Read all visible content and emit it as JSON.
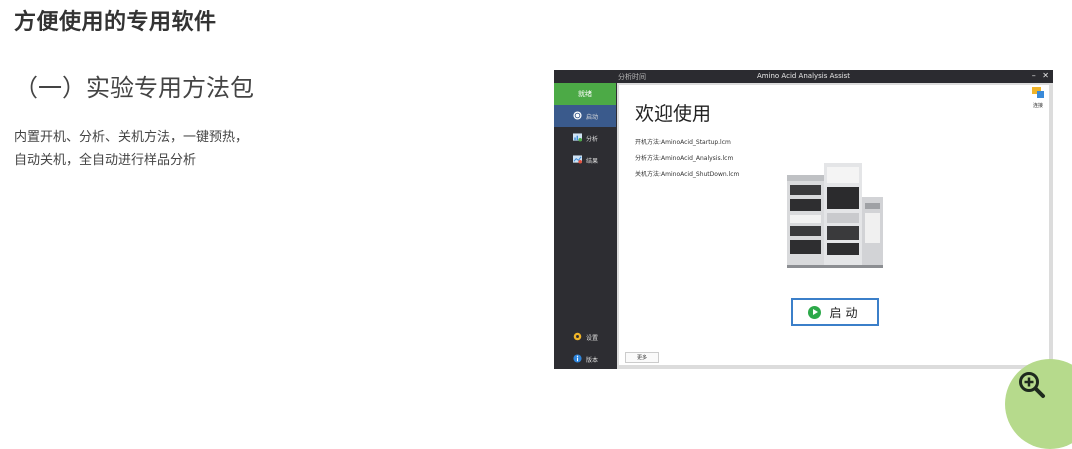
{
  "heading": "方便使用的专用软件",
  "subheading": "（一）实验专用方法包",
  "description": [
    "内置开机、分析、关机方法，一键预热，",
    "自动关机，全自动进行样品分析"
  ],
  "app": {
    "titlebar_left": "分析时间",
    "title": "Amino Acid Analysis Assist",
    "controls": {
      "minimize": "–",
      "close": "✕"
    },
    "sidebar": {
      "top_label": "就绪",
      "items": [
        {
          "label": "启动",
          "icon": "power-icon",
          "active": true
        },
        {
          "label": "分析",
          "icon": "chart-icon",
          "active": false
        },
        {
          "label": "结果",
          "icon": "results-icon",
          "active": false
        }
      ],
      "bottom_items": [
        {
          "label": "设置",
          "icon": "gear-icon"
        },
        {
          "label": "版本",
          "icon": "info-icon"
        }
      ]
    },
    "main": {
      "welcome": "欢迎使用",
      "methods": [
        "开机方法:AminoAcid_Startup.lcm",
        "分析方法:AminoAcid_Analysis.lcm",
        "关机方法:AminoAcid_ShutDown.lcm"
      ],
      "start_button": "启动",
      "more_button": "更多",
      "connect_label": "连接"
    }
  },
  "colors": {
    "accent_green": "#4caa46",
    "active_blue": "#3a5a8c",
    "button_border": "#3b7fc9",
    "zoom_fab": "#b6da8c"
  },
  "zoom_icon": "zoom-in-icon"
}
